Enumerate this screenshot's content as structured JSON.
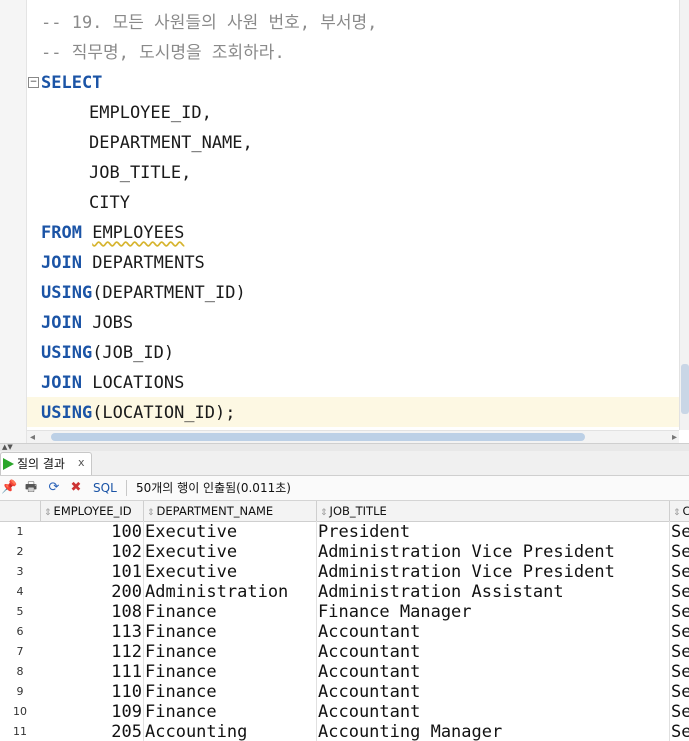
{
  "editor": {
    "comment1": "-- 19. 모든 사원들의 사원 번호, 부서명,",
    "comment2": "-- 직무명, 도시명을 조회하라.",
    "kw_select": "SELECT",
    "col1": "EMPLOYEE_ID,",
    "col2": "DEPARTMENT_NAME,",
    "col3": "JOB_TITLE,",
    "col4": "CITY",
    "kw_from": "FROM",
    "from_table": "EMPLOYEES",
    "kw_join1": "JOIN",
    "join1_table": "DEPARTMENTS",
    "kw_using1": "USING",
    "using1_arg": "(DEPARTMENT_ID)",
    "kw_join2": "JOIN",
    "join2_table": "JOBS",
    "kw_using2": "USING",
    "using2_arg": "(JOB_ID)",
    "kw_join3": "JOIN",
    "join3_table": "LOCATIONS",
    "kw_using3": "USING",
    "using3_arg": "(LOCATION_ID);",
    "fold_symbol": "⊟"
  },
  "results": {
    "tab_label": "질의 결과",
    "tab_close": "x",
    "sql_label": "SQL",
    "status": "50개의 행이 인출됨(0.011초)",
    "columns": [
      "EMPLOYEE_ID",
      "DEPARTMENT_NAME",
      "JOB_TITLE",
      "C"
    ],
    "rows": [
      {
        "n": "1",
        "id": "100",
        "dept": "Executive",
        "job": "President",
        "city": "Se"
      },
      {
        "n": "2",
        "id": "102",
        "dept": "Executive",
        "job": "Administration Vice President",
        "city": "Se"
      },
      {
        "n": "3",
        "id": "101",
        "dept": "Executive",
        "job": "Administration Vice President",
        "city": "Se"
      },
      {
        "n": "4",
        "id": "200",
        "dept": "Administration",
        "job": "Administration Assistant",
        "city": "Se"
      },
      {
        "n": "5",
        "id": "108",
        "dept": "Finance",
        "job": "Finance Manager",
        "city": "Se"
      },
      {
        "n": "6",
        "id": "113",
        "dept": "Finance",
        "job": "Accountant",
        "city": "Se"
      },
      {
        "n": "7",
        "id": "112",
        "dept": "Finance",
        "job": "Accountant",
        "city": "Se"
      },
      {
        "n": "8",
        "id": "111",
        "dept": "Finance",
        "job": "Accountant",
        "city": "Se"
      },
      {
        "n": "9",
        "id": "110",
        "dept": "Finance",
        "job": "Accountant",
        "city": "Se"
      },
      {
        "n": "10",
        "id": "109",
        "dept": "Finance",
        "job": "Accountant",
        "city": "Se"
      },
      {
        "n": "11",
        "id": "205",
        "dept": "Accounting",
        "job": "Accounting Manager",
        "city": "Se"
      }
    ]
  },
  "colors": {
    "keyword": "#1b54a6",
    "comment": "#8a8a8a",
    "current_line": "#fdf8e3",
    "run_icon": "#2aa62a"
  }
}
